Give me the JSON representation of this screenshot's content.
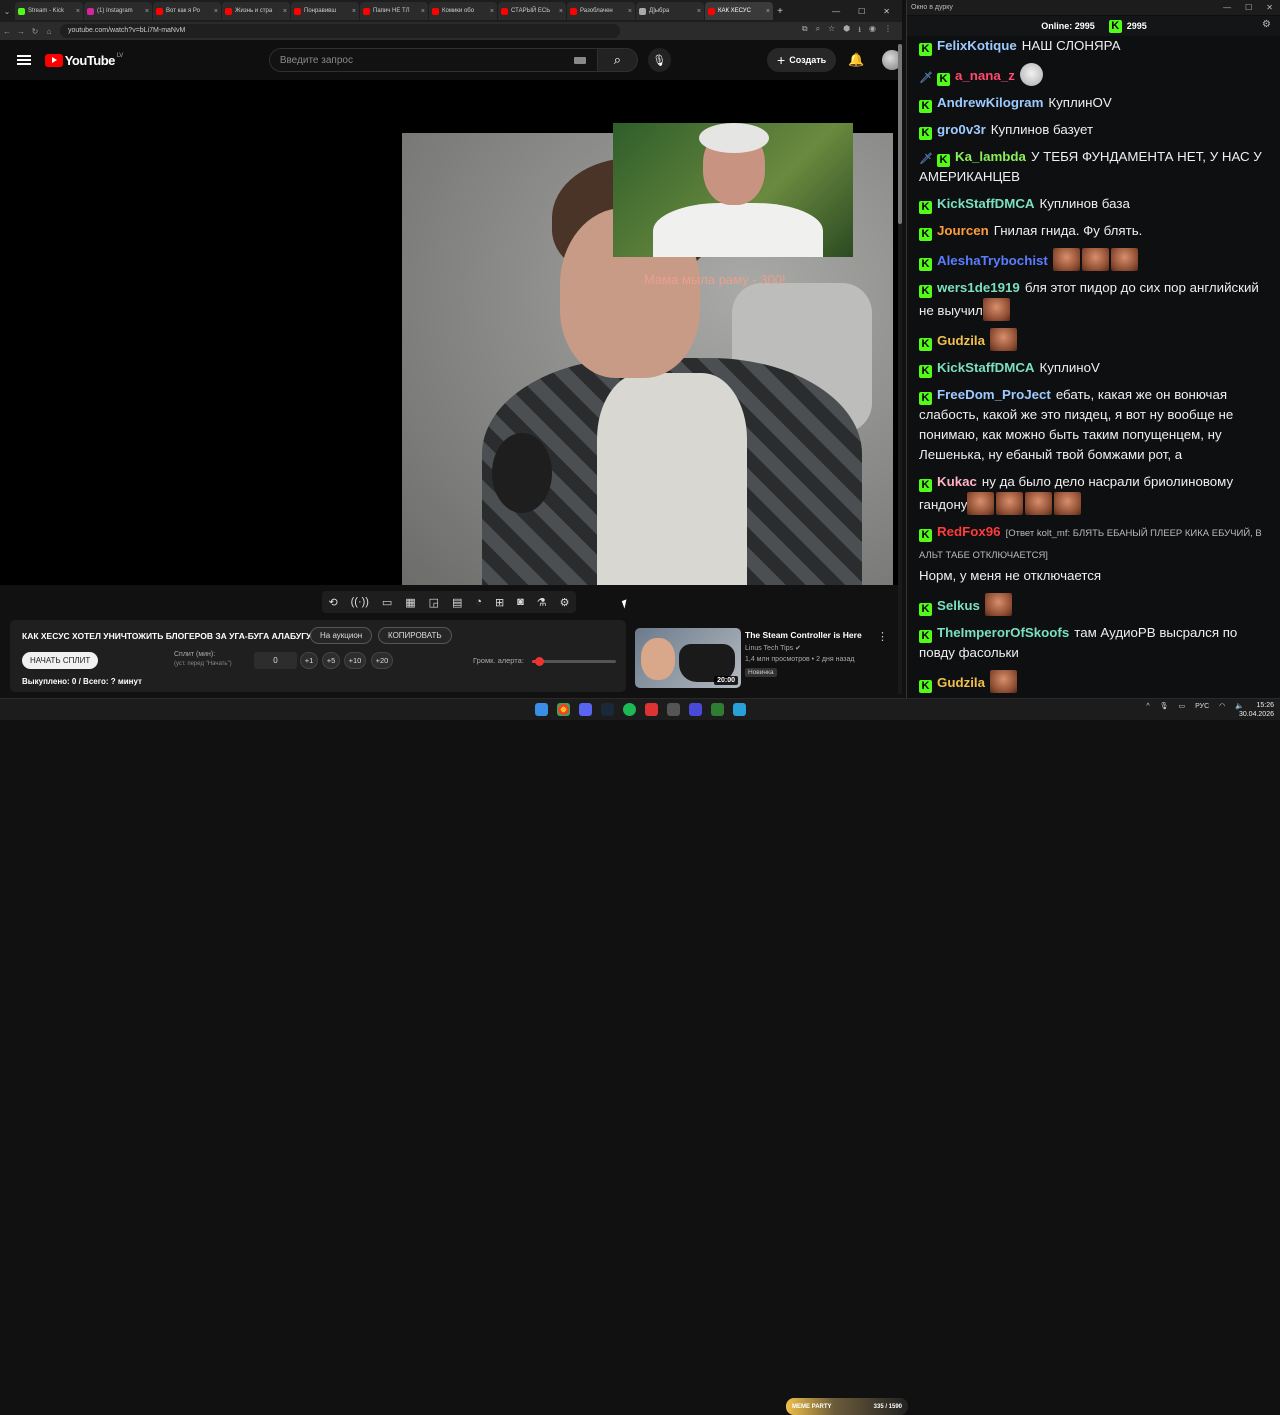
{
  "browser": {
    "tabs": [
      {
        "label": "Stream - Kick",
        "color": "#53fc18"
      },
      {
        "label": "(1) Instagram",
        "color": "#d6249f"
      },
      {
        "label": "Вот как я Ро",
        "color": "#ff0000"
      },
      {
        "label": "Жизнь и стра",
        "color": "#ff0000"
      },
      {
        "label": "Понравивш",
        "color": "#ff0000"
      },
      {
        "label": "Папич НЕ ТЛ",
        "color": "#ff0000"
      },
      {
        "label": "Комики обо",
        "color": "#ff0000"
      },
      {
        "label": "СТАРЫЙ ЕСЬ",
        "color": "#ff0000"
      },
      {
        "label": "Разоблачен",
        "color": "#ff0000"
      },
      {
        "label": "Д]ыбра",
        "color": "#aaaaaa"
      },
      {
        "label": "КАК ХЕСУС",
        "color": "#ff0000"
      }
    ],
    "url": "youtube.com/watch?v=bLi7M-maNvM"
  },
  "youtube": {
    "logo_text": "YouTube",
    "logo_region": "LV",
    "search_placeholder": "Введите запрос",
    "create_label": "Создать"
  },
  "video": {
    "overlay_text": "Мама мыла раму - 300!"
  },
  "panel": {
    "title": "КАК ХЕСУС ХОТЕЛ УНИЧТОЖИТЬ БЛОГЕРОВ ЗА УГА-БУГА АЛАБУГУ",
    "auction_btn": "На аукцион",
    "copy_btn": "КОПИРОВАТЬ",
    "start_split_btn": "НАЧАТЬ СПЛИТ",
    "split_label": "Сплит (мин):",
    "split_sub": "(уст. перед \"Начать\")",
    "split_value": "0",
    "steps": [
      "+1",
      "+5",
      "+10",
      "+20"
    ],
    "volume_label": "Громк. алерта:",
    "volume_level": 0.08,
    "bought": "Выкуплено: 0 / Всего: ? минут"
  },
  "recommended": {
    "title": "The Steam Controller is Here",
    "channel": "Linus Tech Tips",
    "meta": "1,4 млн просмотров • 2 дня назад",
    "badge": "Новинка",
    "duration": "20:00"
  },
  "chat": {
    "window_title": "Окно в дурку",
    "online_label": "Online:",
    "online_count": "2995",
    "viewer_count": "2995",
    "messages": [
      {
        "user": "FelixKotique",
        "color": "#9ecbff",
        "text": "НАШ СЛОНЯРА",
        "badge": "k",
        "emotes": 0
      },
      {
        "user": "a_nana_z",
        "color": "#ff4a6e",
        "text": "",
        "badge": "sk",
        "emotes": 0,
        "round_emote": true
      },
      {
        "user": "AndrewKilogram",
        "color": "#9ecbff",
        "text": "КуплинOV",
        "badge": "k",
        "emotes": 0
      },
      {
        "user": "gro0v3r",
        "color": "#9ecbff",
        "text": "Куплинов базует",
        "badge": "k",
        "emotes": 0
      },
      {
        "user": "Ka_lambda",
        "color": "#8af05a",
        "text": "У ТЕБЯ ФУНДАМЕНТА НЕТ, У НАС У АМЕРИКАНЦЕВ",
        "badge": "sk",
        "emotes": 0
      },
      {
        "user": "KickStaffDMCA",
        "color": "#7be0c0",
        "text": "Куплинов база",
        "badge": "k",
        "emotes": 0
      },
      {
        "user": "Jourcen",
        "color": "#ff9d3a",
        "text": "Гнилая гнида. Фу блять.",
        "badge": "k",
        "emotes": 0
      },
      {
        "user": "AleshaTrybochist",
        "color": "#5a7dff",
        "text": "",
        "badge": "k",
        "emotes": 3
      },
      {
        "user": "wers1de1919",
        "color": "#7be0c0",
        "text": "бля этот пидор до сих пор английский не выучил",
        "badge": "k",
        "emotes": 1
      },
      {
        "user": "Gudzila",
        "color": "#f0c04a",
        "text": "",
        "badge": "k",
        "emotes": 1
      },
      {
        "user": "KickStaffDMCA",
        "color": "#7be0c0",
        "text": "КуплиноV",
        "badge": "k",
        "emotes": 0
      },
      {
        "user": "FreeDom_ProJect",
        "color": "#9ecbff",
        "text": "ебать, какая же он вонючая слабость, какой же это пиздец, я вот ну вообще не понимаю, как можно быть таким попущенцем, ну Лешенька, ну ебаный твой бомжами рот, а",
        "badge": "k",
        "emotes": 0
      },
      {
        "user": "Kukac",
        "color": "#ffb3c7",
        "text": "ну да было дело насрали бриолиновому гандону",
        "badge": "k",
        "emotes": 4
      },
      {
        "user": "RedFox96",
        "color": "#ff3b3b",
        "reply": "[Ответ kolt_mf: БЛЯТЬ ЕБАНЫЙ ПЛЕЕР КИКА ЕБУЧИЙ, В АЛЬТ ТАБЕ ОТКЛЮЧАЕТСЯ]",
        "text": "Норм, у меня не отключается",
        "badge": "k",
        "emotes": 0
      },
      {
        "user": "Selkus",
        "color": "#7be0c0",
        "text": "",
        "badge": "k",
        "emotes": 1
      },
      {
        "user": "TheImperorOfSkoofs",
        "color": "#7be0c0",
        "text": "там АудиоРВ высрался по повду фасольки",
        "badge": "k",
        "emotes": 0
      },
      {
        "user": "Gudzila",
        "color": "#f0c04a",
        "text": "",
        "badge": "k",
        "emotes": 1
      }
    ]
  },
  "taskbar": {
    "meme_label": "MEME PARTY",
    "meme_count": "335 / 1590",
    "lang": "РУС",
    "time": "15:26",
    "date": "30.04.2026"
  }
}
